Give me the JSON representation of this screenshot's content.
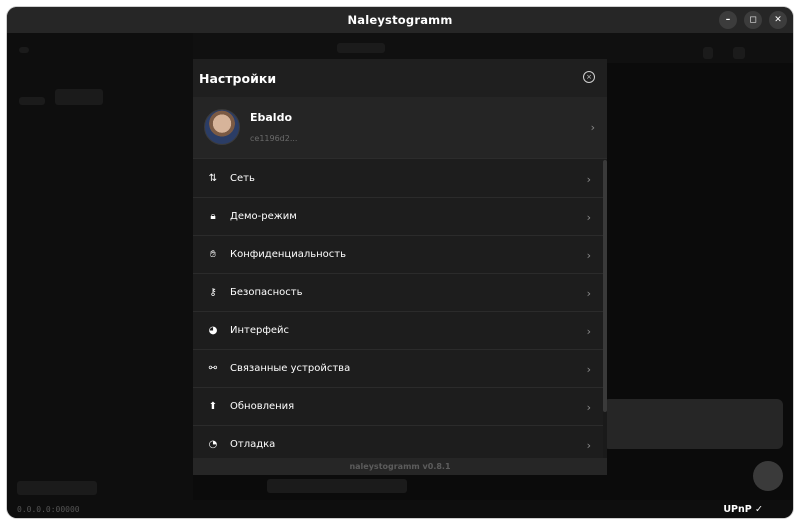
{
  "window": {
    "title": "Naleystogramm",
    "buttons": [
      {
        "name": "minimize",
        "glyph": "–"
      },
      {
        "name": "maximize",
        "glyph": "◻"
      },
      {
        "name": "close",
        "glyph": "✕"
      }
    ]
  },
  "settings": {
    "title": "Настройки",
    "close_glyph": "×",
    "profile": {
      "name": "Ebaldo",
      "id": "ce1196d2...",
      "chevron": "›"
    },
    "items": [
      {
        "icon": "arrows-updown-icon",
        "glyph": "⇅",
        "label": "Сеть",
        "chevron": "›"
      },
      {
        "icon": "lock-icon",
        "glyph": "🔒︎",
        "label": "Демо-режим",
        "chevron": "›"
      },
      {
        "icon": "hand-icon",
        "glyph": "✋︎",
        "label": "Конфиденциальность",
        "chevron": "›"
      },
      {
        "icon": "key-icon",
        "glyph": "⚷",
        "label": "Безопасность",
        "chevron": "›"
      },
      {
        "icon": "palette-icon",
        "glyph": "◕",
        "label": "Интерфейс",
        "chevron": "›"
      },
      {
        "icon": "link-devices-icon",
        "glyph": "⚯",
        "label": "Связанные устройства",
        "chevron": "›"
      },
      {
        "icon": "arrow-up-icon",
        "glyph": "⬆",
        "label": "Обновления",
        "chevron": "›"
      },
      {
        "icon": "pie-chart-icon",
        "glyph": "◔",
        "label": "Отладка",
        "chevron": "›"
      }
    ],
    "footer": "naleystogramm  v0.8.1"
  },
  "statusbar": {
    "ip": "0.0.0.0:00000",
    "upnp": "UPnP ✓"
  }
}
